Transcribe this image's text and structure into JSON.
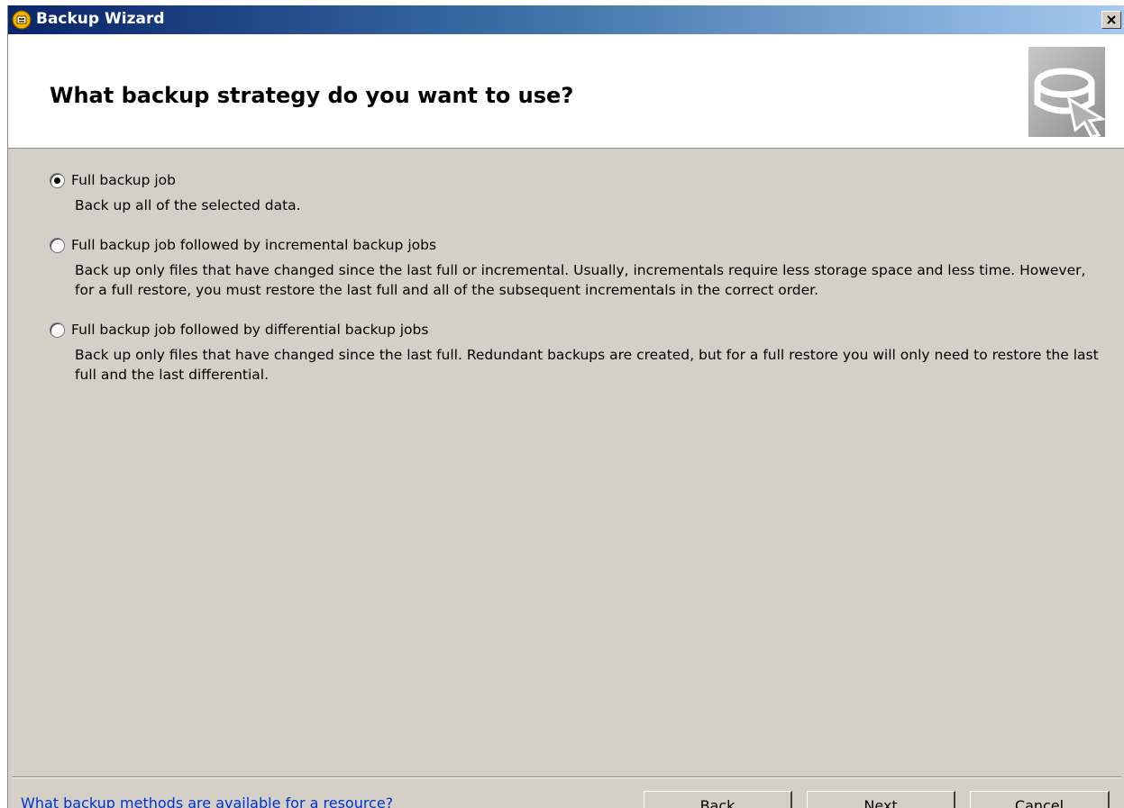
{
  "window": {
    "title": "Backup Wizard",
    "close_glyph": "×"
  },
  "header": {
    "heading": "What backup strategy do you want to use?"
  },
  "options": [
    {
      "label": "Full backup job",
      "description": "Back up all of the selected data.",
      "selected": true
    },
    {
      "label": "Full backup job followed by incremental backup jobs",
      "description": "Back up only files that have changed since the last full or incremental.  Usually, incrementals require less storage space and less time.  However, for a full restore, you must restore the last full and all of the subsequent incrementals in the correct order.",
      "selected": false
    },
    {
      "label": "Full backup job followed by differential backup jobs",
      "description": "Back up only files that have changed since the last full.  Redundant backups are created, but for a full restore you will only need to restore the last full and the last differential.",
      "selected": false
    }
  ],
  "footer": {
    "help_link": "What backup methods are available for a resource?",
    "back_label": "Back",
    "next_label": "Next",
    "cancel_label": "Cancel"
  },
  "colors": {
    "dialog_bg": "#d4d0c8",
    "title_gradient_start": "#0a246a",
    "title_gradient_end": "#a6caf0",
    "link": "#0033cc"
  },
  "icons": {
    "app": "backup-drive-icon",
    "header": "wizard-disk-cursor-icon",
    "close": "close-icon"
  }
}
